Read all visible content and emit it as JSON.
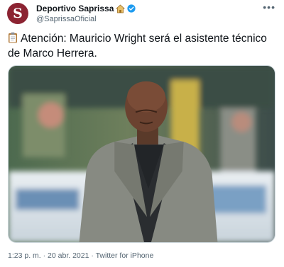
{
  "account": {
    "name": "Deportivo Saprissa",
    "handle": "@SaprissaOficial",
    "avatar_letter": "S",
    "avatar_color": "#8c2332",
    "verified": true
  },
  "tweet": {
    "text": "Atención: Mauricio Wright será el asistente técnico de Marco Herrera."
  },
  "meta": {
    "time": "1:23 p. m.",
    "separator": "·",
    "date": "20 abr. 2021",
    "source": "Twitter for iPhone"
  },
  "icons": {
    "more": "more-icon",
    "verified": "verified-icon",
    "badge": "house-icon",
    "clipboard": "clipboard-icon"
  },
  "colors": {
    "verified": "#1d9bf0",
    "secondary_text": "#536471"
  }
}
